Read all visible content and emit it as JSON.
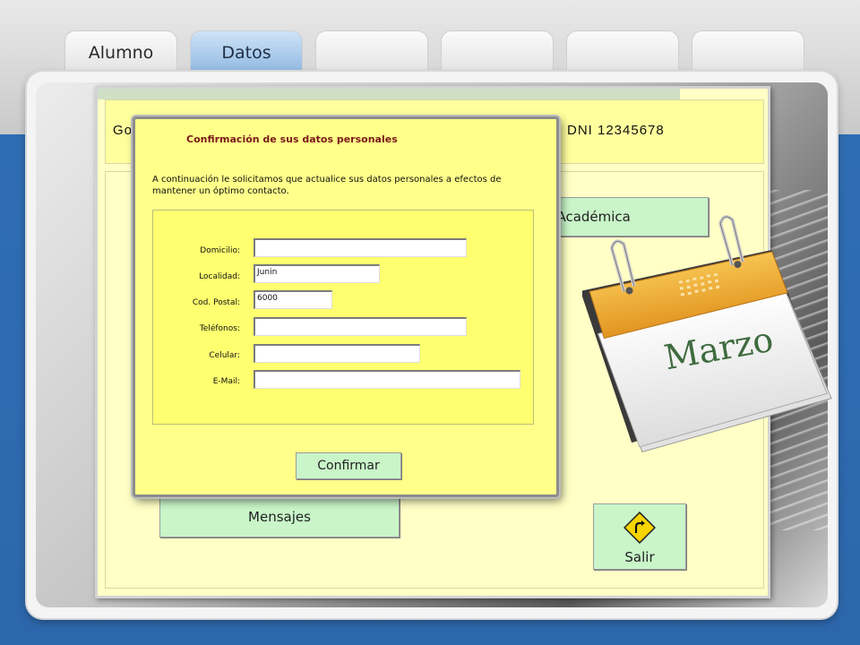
{
  "tabs": [
    {
      "label": "Alumno",
      "active": false
    },
    {
      "label": "Datos",
      "active": true
    },
    {
      "label": "",
      "active": false
    },
    {
      "label": "",
      "active": false
    },
    {
      "label": "",
      "active": false
    },
    {
      "label": "",
      "active": false
    }
  ],
  "app": {
    "header_left": "Go",
    "header_right": "DNI 12345678",
    "buttons": {
      "academic": "ón Académica",
      "messages": "Mensajes",
      "exit": "Salir"
    }
  },
  "dialog": {
    "title": "Confirmación de sus datos personales",
    "message": "A continuación le solicitamos que actualice sus datos personales a efectos de mantener un óptimo contacto.",
    "fields": {
      "domicilio": {
        "label": "Domicilio:",
        "value": ""
      },
      "localidad": {
        "label": "Localidad:",
        "value": "Junin"
      },
      "cod_postal": {
        "label": "Cod. Postal:",
        "value": "6000"
      },
      "telefonos": {
        "label": "Teléfonos:",
        "value": ""
      },
      "celular": {
        "label": "Celular:",
        "value": ""
      },
      "email": {
        "label": "E-Mail:",
        "value": ""
      }
    },
    "confirm_label": "Confirmar"
  },
  "calendar": {
    "month": "Marzo"
  },
  "colors": {
    "app_bg": "#ffffc6",
    "dialog_bg": "#ffff8a",
    "button_green": "#c9f5c9",
    "calendar_orange": "#f0a830",
    "calendar_text": "#3f6b3f",
    "tab_active": "#a9cbeb",
    "page_blue": "#2f6db3"
  }
}
